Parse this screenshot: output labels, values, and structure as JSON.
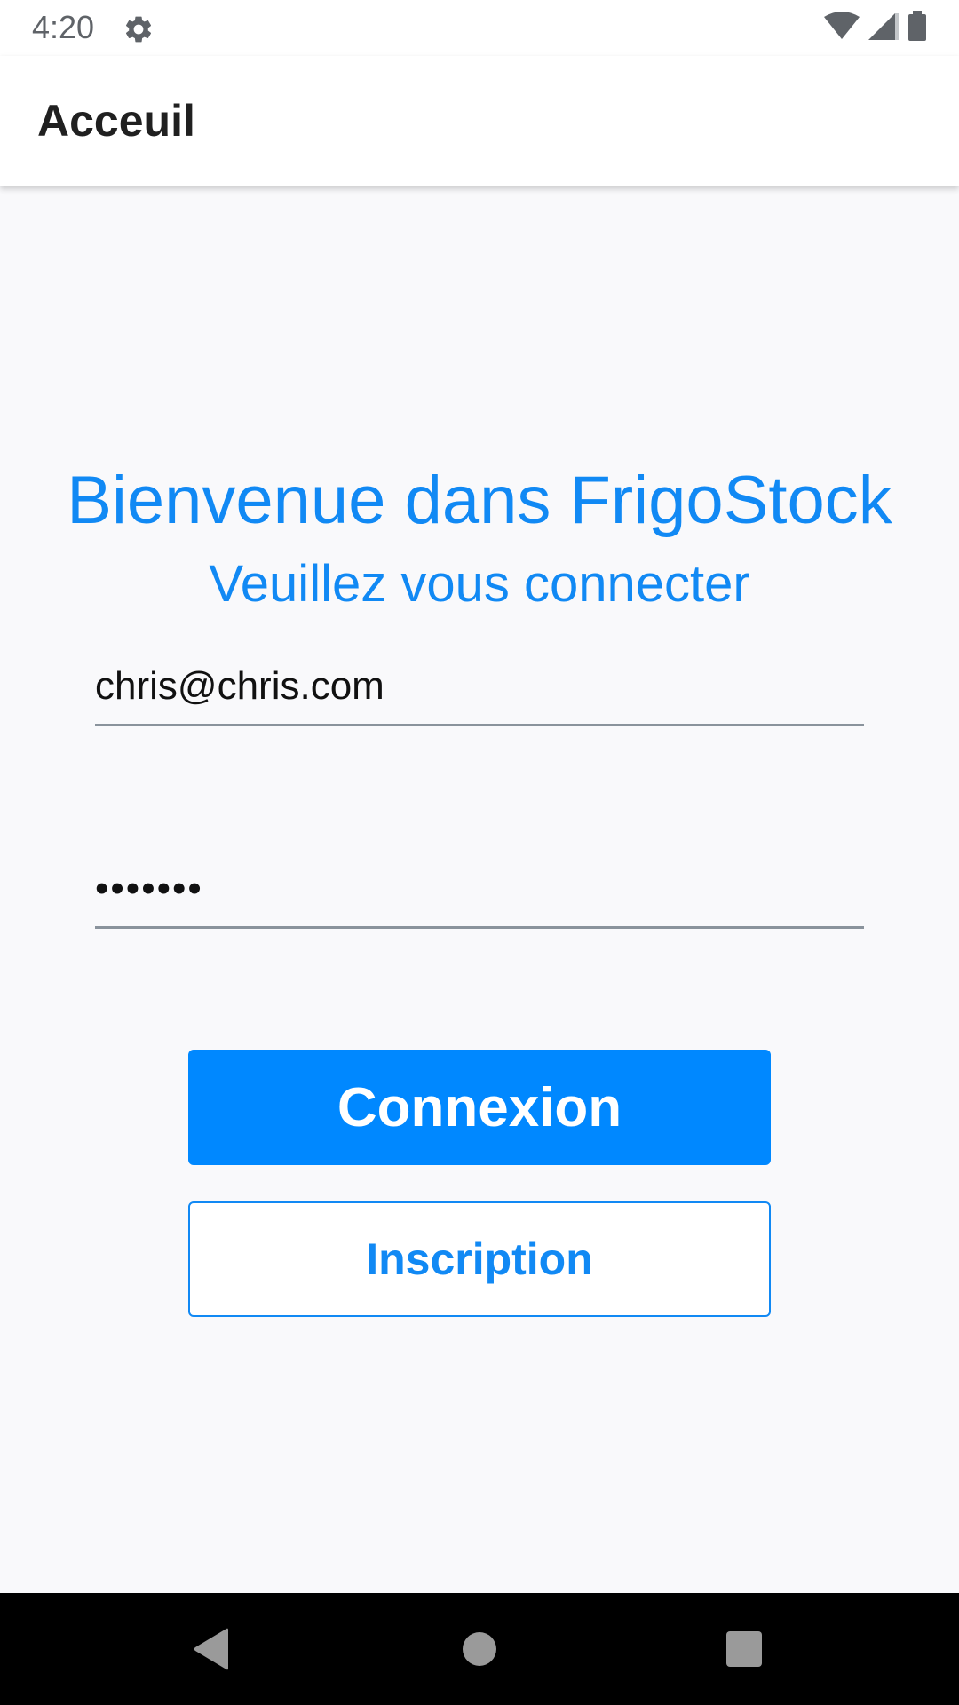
{
  "status_bar": {
    "time": "4:20",
    "icons": [
      "settings-icon",
      "wifi-icon",
      "signal-icon",
      "battery-icon"
    ]
  },
  "app_bar": {
    "title": "Acceuil"
  },
  "login": {
    "title": "Bienvenue dans FrigoStock",
    "subtitle": "Veuillez vous connecter",
    "email_value": "chris@chris.com",
    "password_value": "•••••••",
    "connect_label": "Connexion",
    "signup_label": "Inscription"
  },
  "nav_bar": {
    "icons": [
      "back-icon",
      "home-icon",
      "recents-icon"
    ]
  },
  "colors": {
    "accent": "#1189f4",
    "primary_button": "#0088ff",
    "background": "#f9f9fb",
    "nav_bar": "#000000"
  }
}
